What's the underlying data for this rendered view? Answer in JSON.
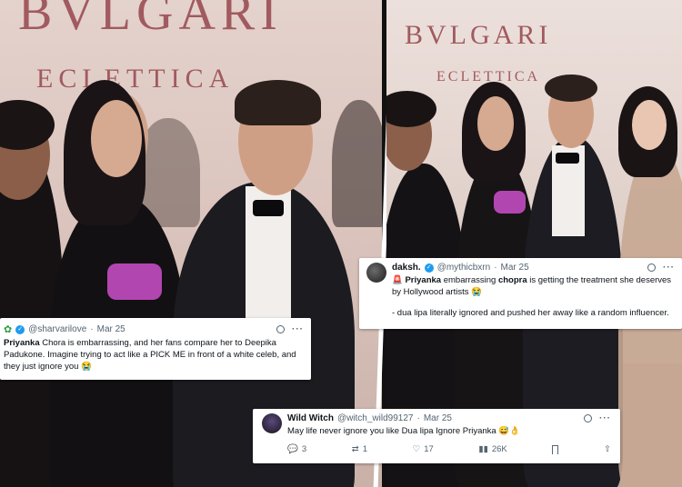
{
  "left_photo": {
    "brand": "BVLGARI",
    "sub": "ECLETTICA"
  },
  "right_photo": {
    "brand": "BVLGARI",
    "sub": "ECLETTICA"
  },
  "tweets": [
    {
      "handle": "@sharvarilove",
      "date": "Mar 25",
      "bold_lead": "Priyanka",
      "text": " Chora is embarrassing, and her fans compare her to Deepika Padukone. Imagine trying to act like a PICK ME in front of a white celeb, and they just ignore you 😭",
      "icons": [
        "verified-icon",
        "grok-icon",
        "more-icon"
      ]
    },
    {
      "name": "daksh.",
      "handle": "@mythicbxrn",
      "date": "Mar 25",
      "line1_prefix": "🚨 ",
      "line1_bold1": "Priyanka",
      "line1_mid": " embarrassing ",
      "line1_bold2": "chopra",
      "line1_rest": " is getting the treatment she deserves by Hollywood artists 😭",
      "line2": "- dua lipa literally ignored and pushed her away like a random influencer."
    },
    {
      "name": "Wild Witch",
      "handle": "@witch_wild99127",
      "date": "Mar 25",
      "text": "May life never ignore you like Dua lipa Ignore Priyanka 😅👌",
      "replies": "3",
      "reposts": "1",
      "likes": "17",
      "views": "26K"
    }
  ],
  "colors": {
    "brand": "#a15a5f",
    "tweet_bg": "#ffffff",
    "muted": "#536471",
    "verified": "#1d9bf0"
  }
}
